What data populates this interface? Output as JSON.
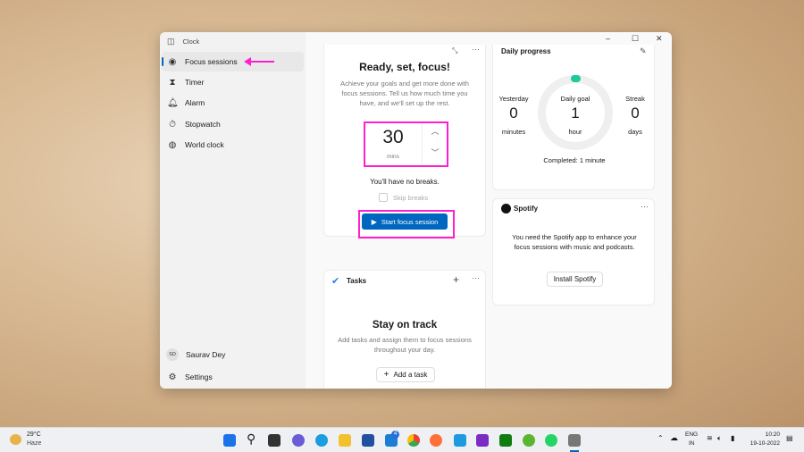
{
  "window": {
    "app_title": "Clock",
    "controls": {
      "minimize": "–",
      "maximize": "☐",
      "close": "✕"
    }
  },
  "sidebar": {
    "items": [
      {
        "label": "Focus sessions",
        "icon": "focus-icon",
        "selected": true
      },
      {
        "label": "Timer",
        "icon": "hourglass-icon"
      },
      {
        "label": "Alarm",
        "icon": "bell-icon"
      },
      {
        "label": "Stopwatch",
        "icon": "stopwatch-icon"
      },
      {
        "label": "World clock",
        "icon": "globe-icon"
      }
    ],
    "user": {
      "initials": "SD",
      "name": "Saurav Dey"
    },
    "settings_label": "Settings"
  },
  "annotation_color": "#ff1fd0",
  "focus": {
    "title": "Ready, set, focus!",
    "description": "Achieve your goals and get more done with focus sessions. Tell us how much time you have, and we'll set up the rest.",
    "minutes": "30",
    "unit": "mins",
    "breaks_text": "You'll have no breaks.",
    "skip_breaks_label": "Skip breaks",
    "skip_breaks_checked": false,
    "start_label": "Start focus session",
    "accent": "#0067c0"
  },
  "progress": {
    "title": "Daily progress",
    "yesterday_label": "Yesterday",
    "yesterday_value": "0",
    "yesterday_unit": "minutes",
    "goal_label": "Daily goal",
    "goal_value": "1",
    "goal_unit": "hour",
    "streak_label": "Streak",
    "streak_value": "0",
    "streak_unit": "days",
    "completed": "Completed: 1 minute",
    "ring_color": "#1ec99a",
    "progress_fraction": 0.017
  },
  "spotify": {
    "title": "Spotify",
    "message": "You need the Spotify app to enhance your focus sessions with music and podcasts.",
    "install_label": "Install Spotify"
  },
  "tasks": {
    "title": "Tasks",
    "heading": "Stay on track",
    "description": "Add tasks and assign them to focus sessions throughout your day.",
    "add_label": "Add a task"
  },
  "taskbar": {
    "weather_temp": "29°C",
    "weather_desc": "Haze",
    "lang": "ENG",
    "region": "IN",
    "time": "10:20",
    "date": "19-10-2022",
    "mail_badge": "4"
  }
}
